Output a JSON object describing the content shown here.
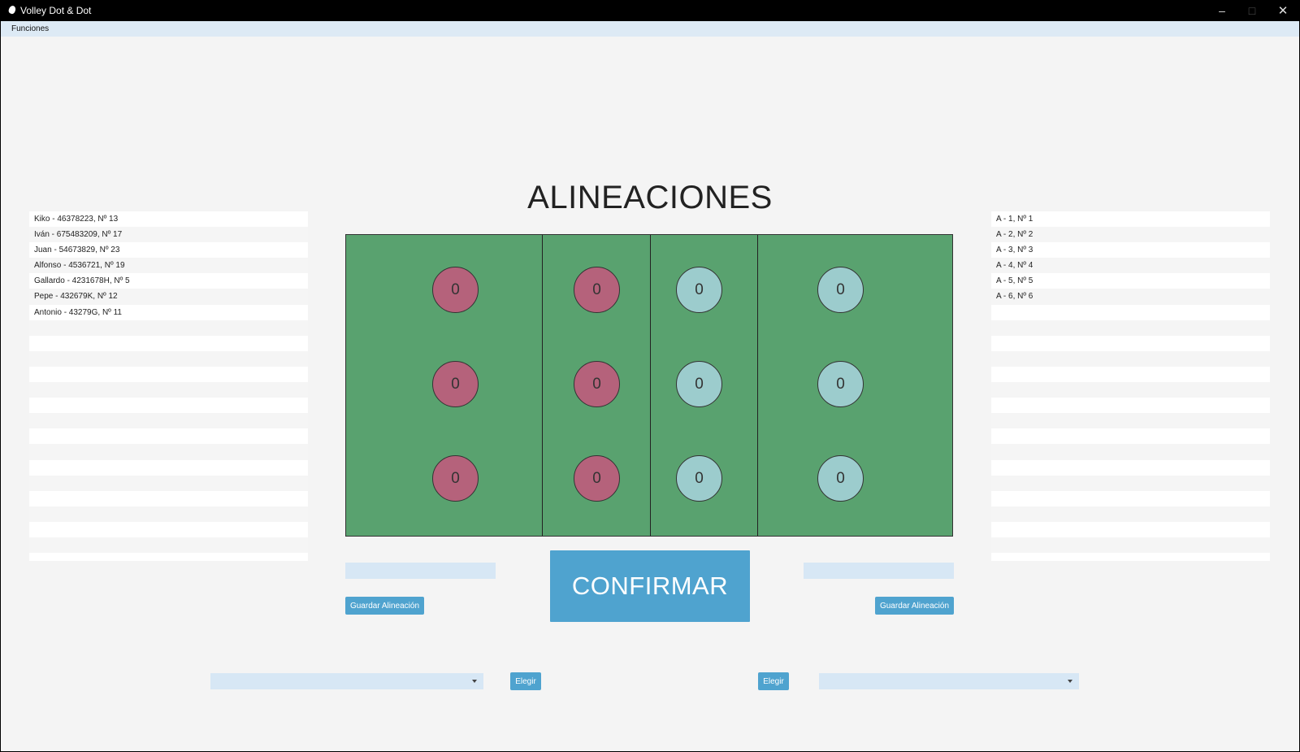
{
  "window": {
    "title": "Volley Dot & Dot"
  },
  "menu": {
    "funciones": "Funciones"
  },
  "heading": "ALINEACIONES",
  "left_team_list": [
    "Kiko - 46378223, Nº 13",
    "Iván - 675483209, Nº 17",
    "Juan - 54673829, Nº 23",
    "Alfonso - 4536721, Nº 19",
    "Gallardo - 4231678H, Nº 5",
    "Pepe - 432679K, Nº 12",
    "Antonio - 43279G, Nº 11",
    "",
    "",
    "",
    "",
    "",
    "",
    "",
    "",
    "",
    "",
    "",
    "",
    "",
    "",
    "",
    ""
  ],
  "right_team_list": [
    "A - 1, Nº 1",
    "A - 2, Nº 2",
    "A - 3, Nº 3",
    "A - 4, Nº 4",
    "A - 5, Nº 5",
    "A - 6, Nº 6",
    "",
    "",
    "",
    "",
    "",
    "",
    "",
    "",
    "",
    "",
    "",
    "",
    "",
    "",
    "",
    "",
    ""
  ],
  "court": {
    "home_players": [
      "0",
      "0",
      "0",
      "0",
      "0",
      "0"
    ],
    "away_players": [
      "0",
      "0",
      "0",
      "0",
      "0",
      "0"
    ]
  },
  "left_controls": {
    "lineup_name_value": "",
    "save_label": "Guardar Alineación",
    "select_value": "",
    "choose_label": "Elegir"
  },
  "right_controls": {
    "lineup_name_value": "",
    "save_label": "Guardar Alineación",
    "select_value": "",
    "choose_label": "Elegir"
  },
  "confirm_label": "CONFIRMAR",
  "colors": {
    "court_green": "#59a26f",
    "home_team": "#b5627b",
    "away_team": "#9ccccd",
    "accent_button": "#4fa3cf"
  }
}
